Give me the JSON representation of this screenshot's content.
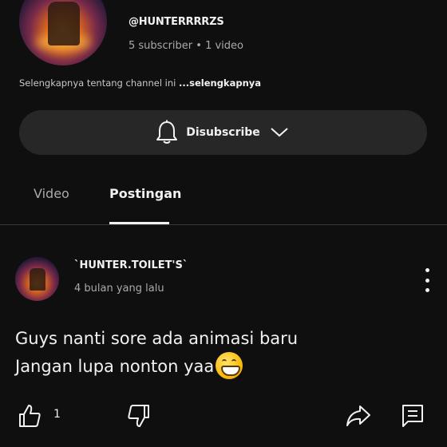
{
  "channel": {
    "handle": "@HUNTERRRRZS",
    "stats": "5 subscriber • 1 video",
    "about_text": "Selengkapnya tentang channel ini ",
    "about_more": "...selengkapnya"
  },
  "subscribe_button": {
    "label": "Disubscribe"
  },
  "tabs": [
    {
      "label": "Video",
      "active": false
    },
    {
      "label": "Postingan",
      "active": true
    }
  ],
  "post": {
    "author": "`HUNTER.TOILET'S`",
    "time": "4 bulan yang lalu",
    "text_lines": [
      "Guys nanti sore ada animasi baru",
      "Jangan lupa nonton yaa"
    ],
    "emoji": "grinning-face-emoji",
    "like_count": "1"
  },
  "colors": {
    "background": "#0f0f0f",
    "button": "#272727",
    "secondary_text": "#aaaaaa"
  },
  "icons": [
    "bell-icon",
    "chevron-down-icon",
    "more-vert-icon",
    "thumb-up-icon",
    "thumb-down-icon",
    "share-icon",
    "comment-icon"
  ]
}
